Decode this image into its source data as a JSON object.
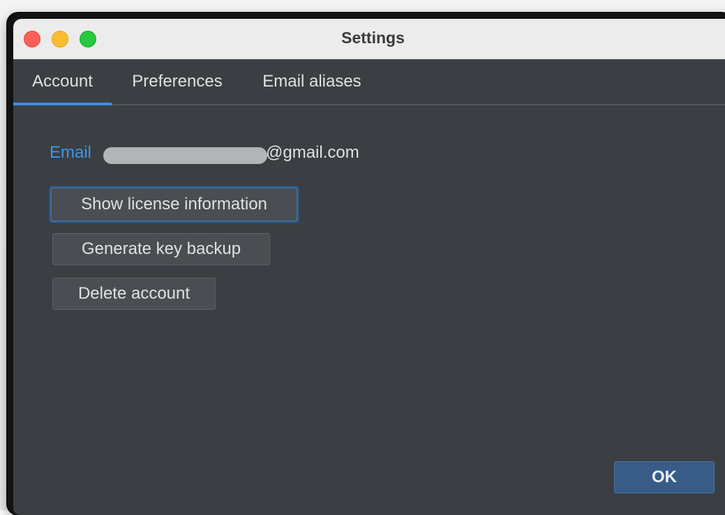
{
  "window": {
    "title": "Settings"
  },
  "tabs": [
    {
      "label": "Account",
      "active": true
    },
    {
      "label": "Preferences",
      "active": false
    },
    {
      "label": "Email aliases",
      "active": false
    }
  ],
  "account": {
    "email_label": "Email",
    "email_value_visible": "@gmail.com",
    "buttons": {
      "show_license": "Show license information",
      "generate_backup": "Generate key backup",
      "delete_account": "Delete account"
    }
  },
  "footer": {
    "ok_label": "OK"
  },
  "colors": {
    "accent": "#3d8fe0",
    "email_label": "#3b96ea",
    "panel_background": "#3b3e42",
    "ok_button": "#385c87"
  }
}
